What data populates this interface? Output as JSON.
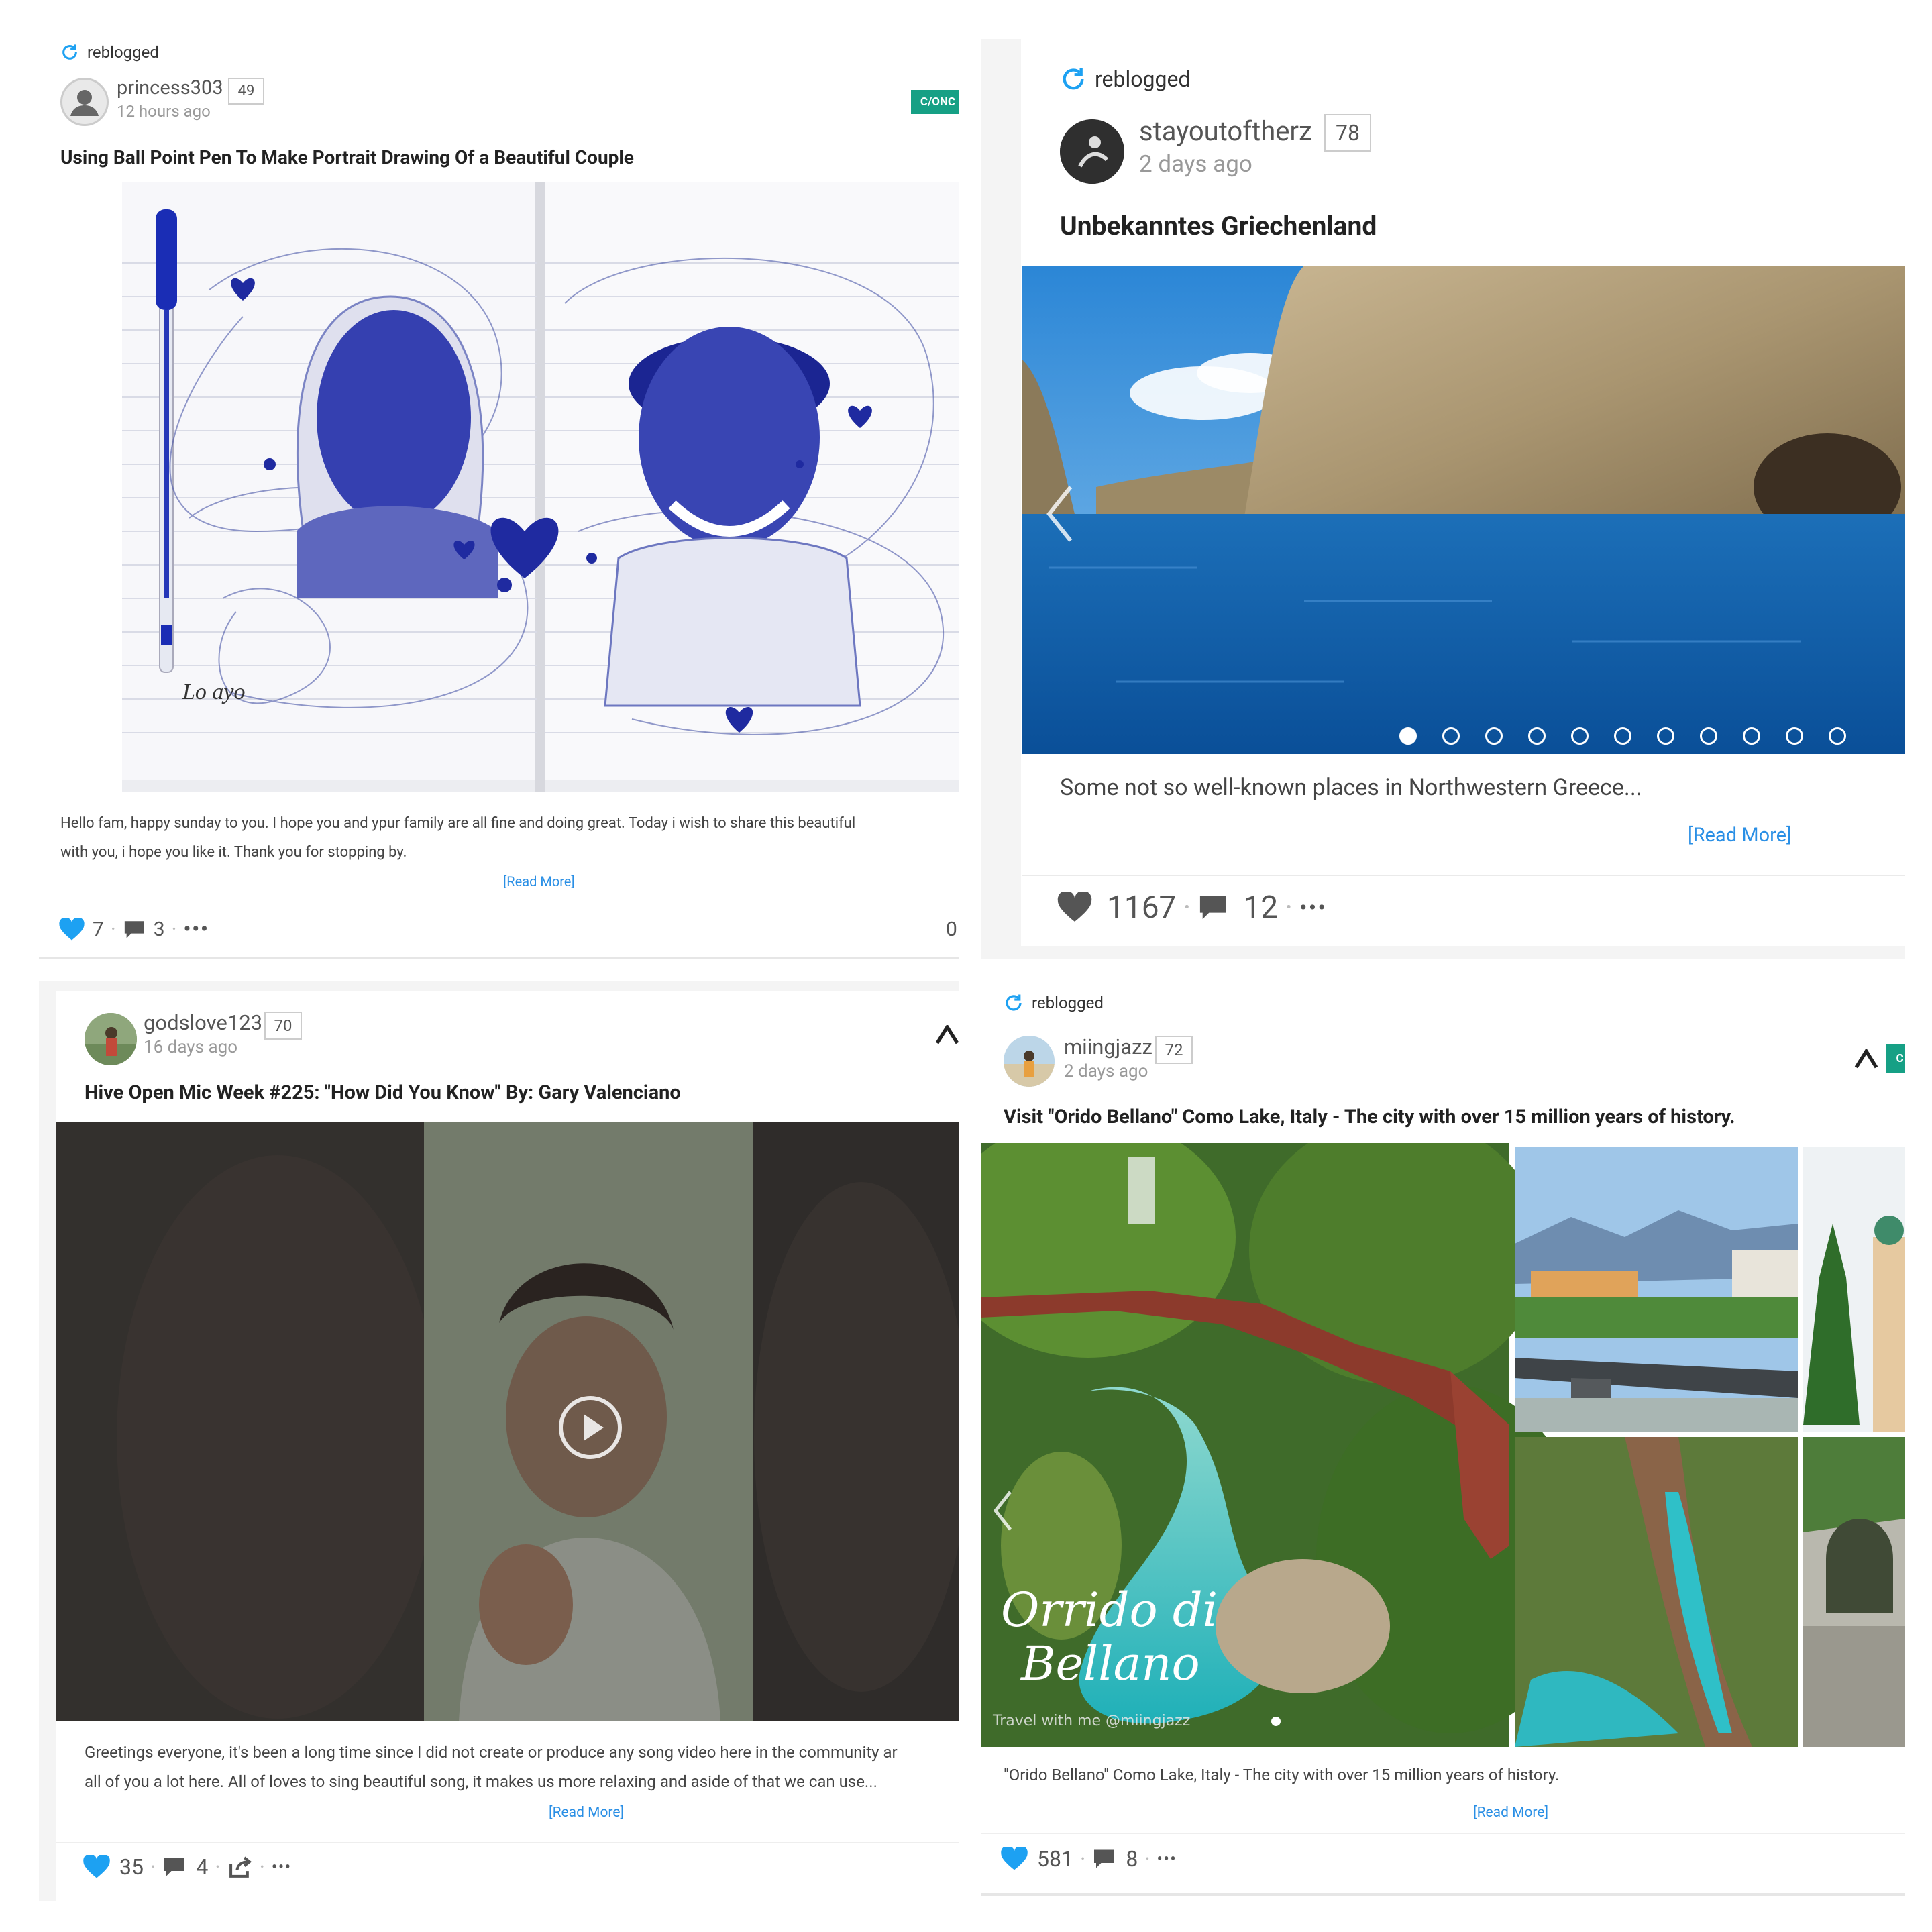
{
  "post1": {
    "reblogged": "reblogged",
    "username": "princess303",
    "reputation": "49",
    "time_ago": "12 hours ago",
    "community_tag": "C/ONC",
    "title": "Using Ball Point Pen To Make Portrait Drawing Of a Beautiful Couple",
    "excerpt_line1": "Hello fam, happy sunday to you. I hope you and ypur family are all fine and doing great. Today i wish to share this beautiful",
    "excerpt_line2": "with you, i hope you like it. Thank you for stopping by.",
    "read_more": "[Read More]",
    "likes": "7",
    "comments": "3",
    "payout": "0."
  },
  "post2": {
    "reblogged": "reblogged",
    "username": "stayoutoftherz",
    "reputation": "78",
    "time_ago": "2 days ago",
    "title": "Unbekanntes Griechenland",
    "excerpt": "Some not so well-known places in Northwestern Greece...",
    "read_more": "[Read More]",
    "likes": "1167",
    "comments": "12",
    "carousel_slides": 11,
    "carousel_active": 1
  },
  "post3": {
    "username": "godslove123",
    "reputation": "70",
    "time_ago": "16 days ago",
    "title": "Hive Open Mic Week #225: \"How Did You Know\" By: Gary Valenciano",
    "excerpt_line1": "Greetings everyone, it's been a long time since I did not create or produce any song video here in the community ar",
    "excerpt_line2": "all of you a lot here. All of loves to sing beautiful song, it makes us more relaxing and aside of that we can use...",
    "read_more": "[Read More]",
    "likes": "35",
    "comments": "4"
  },
  "post4": {
    "reblogged": "reblogged",
    "username": "miingjazz",
    "reputation": "72",
    "time_ago": "2 days ago",
    "title": "Visit \"Orido Bellano\" Como Lake, Italy - The city with over 15 million years of history.",
    "image_caption_1": "Orrido di",
    "image_caption_2": "Bellano",
    "image_watermark": "Travel with me @miingjazz",
    "excerpt": "\"Orido Bellano\" Como Lake, Italy - The city with over 15 million years of history.",
    "read_more": "[Read More]",
    "likes": "581",
    "comments": "8",
    "community_tag": "C"
  },
  "colors": {
    "accent_blue": "#1da1f2",
    "link_blue": "#2a8fe5",
    "tag_green": "#16a085"
  }
}
